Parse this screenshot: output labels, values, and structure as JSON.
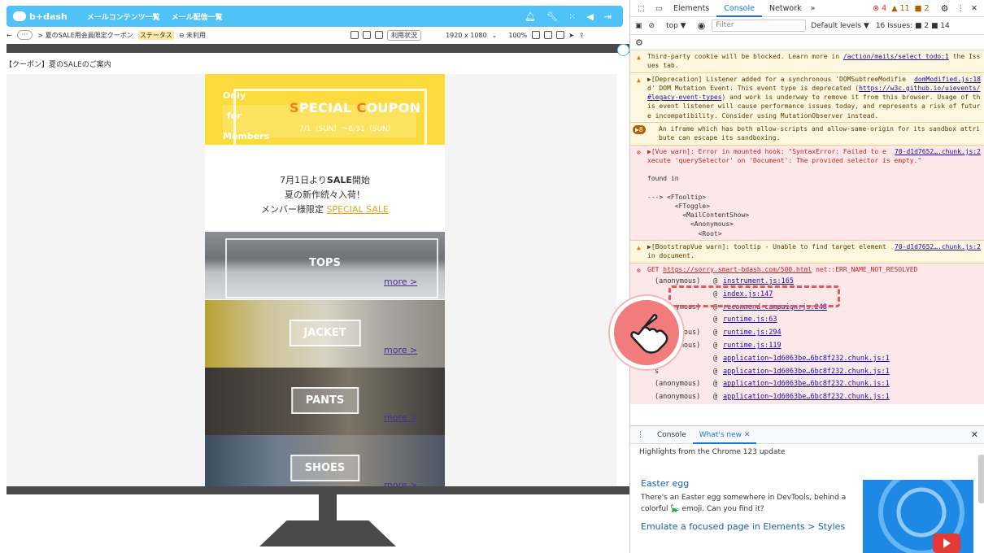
{
  "app": {
    "logo_text": "b+dash",
    "nav": [
      "メールコンテンツ一覧",
      "メール配信一覧"
    ]
  },
  "toolbar": {
    "back": "←",
    "more": "···",
    "breadcrumb": "> 夏のSALE用会員限定クーポン",
    "status_label": "ステータス",
    "status_value": "⊖ 未利用",
    "usage_button": "利用状況",
    "resolution": "1920 x 1080",
    "zoom": "100%"
  },
  "page_title": "【クーポン】夏のSALEのご案内",
  "mail": {
    "hero_only": [
      "Only",
      "for",
      "Members"
    ],
    "hero_s": "S",
    "hero_pecial": "PECIAL ",
    "hero_c": "C",
    "hero_oupon": "OUPON",
    "hero_dates": "7/1（SUN）～8/31（SUN）",
    "line1_pre": "7月1日より",
    "line1_bold": "SALE",
    "line1_post": "開始",
    "line2": "夏の新作続々入荷！",
    "line3_pre": "メンバー様限定 ",
    "line3_link": "SPECIAL SALE",
    "categories": [
      {
        "label": "TOPS",
        "more": "more >"
      },
      {
        "label": "JACKET",
        "more": "more >"
      },
      {
        "label": "PANTS",
        "more": "more >"
      },
      {
        "label": "SHOES",
        "more": "more >"
      }
    ]
  },
  "devtools": {
    "tabs": [
      "Elements",
      "Console",
      "Network"
    ],
    "err_count": "⊗ 4",
    "warn_count": "▲ 11",
    "info_count": "■ 2",
    "context": "top ▼",
    "filter_placeholder": "Filter",
    "levels": "Default levels ▼",
    "issues": "16 Issues: ■ 2 ■ 14",
    "logs": {
      "l1": "Third-party cookie will be blocked. Learn more in ",
      "l1_link": "/action/mails/select_todo:1",
      "l1_tail": " the Issues tab.",
      "l2_src": "domModified.js:18",
      "l2": "▶[Deprecation] Listener added for a synchronous 'DOMSubtreeModified' DOM Mutation Event. This event type is deprecated (",
      "l2_link": "https://w3c.github.io/uievents/#legacy-event-types",
      "l2_tail": ") and work is underway to remove it from this browser. Usage of this event listener will cause performance issues today, and represents a risk of future incompatibility. Consider using MutationObserver instead.",
      "l3_badge": "▶8",
      "l3": "An iframe which has both allow-scripts and allow-same-origin for its sandbox attribute can escape its sandboxing.",
      "l4_src": "70-d1d7652….chunk.js:2",
      "l4": "▶[Vue warn]: Error in mounted hook: \"SyntaxError: Failed to execute 'querySelector' on 'Document': The provided selector is empty.\"",
      "l4_found": "found in",
      "l4_tree": [
        "---> <FTooltip>",
        "       <FToggle>",
        "         <MailContentShow>",
        "           <Anonymous>",
        "             <Root>"
      ],
      "l5_src": "70-d1d7652….chunk.js:2",
      "l5": "▶[BootstrapVue warn]: tooltip - Unable to find target element in document.",
      "l6_pre": "GET ",
      "l6_link": "https://sorry.smart-bdash.com/500.html",
      "l6_post": " net::ERR_NAME_NOT_RESOLVED"
    },
    "stack": [
      {
        "fn": "(anonymous)",
        "src": "instrument.js:165"
      },
      {
        "fn": "",
        "src": "index.js:147"
      },
      {
        "fn": "(anonymous)",
        "src": "recommend-campaign.js:248"
      },
      {
        "fn": "",
        "src": "runtime.js:63"
      },
      {
        "fn": "(anonymous)",
        "src": "runtime.js:294"
      },
      {
        "fn": "(anonymous)",
        "src": "runtime.js:119"
      },
      {
        "fn": "w",
        "src": "application~1d6063be…6bc8f232.chunk.js:1"
      },
      {
        "fn": "s",
        "src": "application~1d6063be…6bc8f232.chunk.js:1"
      },
      {
        "fn": "(anonymous)",
        "src": "application~1d6063be…6bc8f232.chunk.js:1"
      },
      {
        "fn": "(anonymous)",
        "src": "application~1d6063be…6bc8f232.chunk.js:1"
      }
    ],
    "drawer": {
      "tabs": [
        "Console",
        "What's new"
      ],
      "subtitle": "Highlights from the Chrome 123 update",
      "item1_title": "Easter egg",
      "item1_desc": "There's an Easter egg somewhere in DevTools, behind a colorful 🦕 emoji. Can you find it?",
      "item2_title": "Emulate a focused page in Elements > Styles"
    }
  },
  "colors": {
    "header": "#4fc3f7",
    "hero": "#fbdc3c",
    "accent": "#f47c20",
    "error_bg": "#fce8e8",
    "warn_bg": "#fef7e0",
    "pointer": "#f27c7c"
  }
}
